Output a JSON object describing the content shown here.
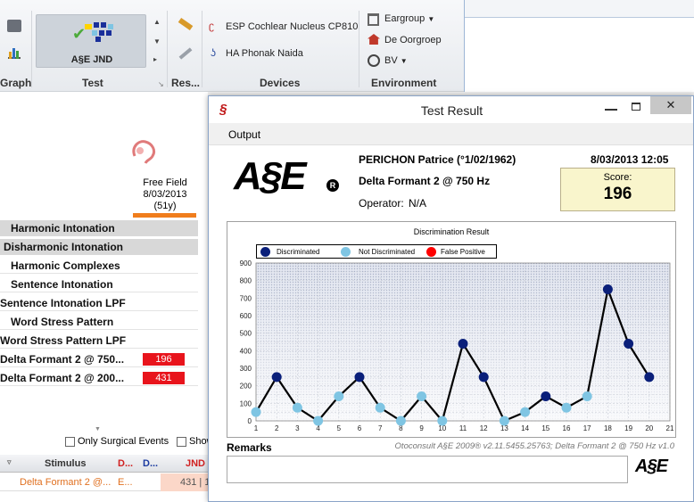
{
  "ribbon": {
    "groups": {
      "graph": "Graph",
      "test": "Test",
      "res": "Res...",
      "devices": "Devices",
      "environment": "Environment"
    },
    "test_button": "A§E JND",
    "devices": [
      "ESP Cochlear Nucleus CP810",
      "HA Phonak Naida"
    ],
    "environment": [
      "Eargroup",
      "De Oorgroep",
      "BV"
    ]
  },
  "session": {
    "label": "Free Field",
    "date": "8/03/2013",
    "age": "(51y)"
  },
  "test_list": [
    {
      "label": "Harmonic Intonation",
      "style": "gray",
      "indent": 12
    },
    {
      "label": "Disharmonic Intonation",
      "style": "gray",
      "indent": 4
    },
    {
      "label": "Harmonic Complexes",
      "style": "row",
      "indent": 12
    },
    {
      "label": "Sentence Intonation",
      "style": "row",
      "indent": 12
    },
    {
      "label": "Sentence Intonation LPF",
      "style": "row",
      "indent": 0
    },
    {
      "label": "Word Stress Pattern",
      "style": "row",
      "indent": 12
    },
    {
      "label": "Word Stress Pattern LPF",
      "style": "row",
      "indent": 0
    },
    {
      "label": "Delta Formant 2 @ 750...",
      "style": "row",
      "indent": 0,
      "badge": "196"
    },
    {
      "label": "Delta Formant 2 @ 200...",
      "style": "row",
      "indent": 0,
      "badge": "431"
    }
  ],
  "filters": {
    "only_surgical": "Only Surgical Events",
    "show": "Show"
  },
  "grid": {
    "headers": [
      "Stimulus",
      "D...",
      "D...",
      "JND"
    ],
    "row": {
      "stimulus": "Delta Formant 2 @...",
      "d1": "E...",
      "jnd": "431 | 1"
    }
  },
  "dialog": {
    "title": "Test Result",
    "menu": "Output",
    "logo": "A§E",
    "patient": "PERICHON Patrice (°1/02/1962)",
    "test": "Delta Formant 2 @ 750 Hz",
    "operator_label": "Operator:",
    "operator": "N/A",
    "datetime": "8/03/2013 12:05",
    "score_label": "Score:",
    "score": "196",
    "remarks_label": "Remarks",
    "footer": "Otoconsult A§E 2009® v2.11.5455.25763; Delta Formant 2 @ 750 Hz v1.0"
  },
  "chart_data": {
    "type": "line",
    "title": "Discrimination Result",
    "legend": [
      "Discriminated",
      "Not Discriminated",
      "False Positive"
    ],
    "colors": {
      "discriminated": "#0a1f7a",
      "not_discriminated": "#7fc5e3",
      "false_positive": "#ff0000"
    },
    "x": [
      1,
      2,
      3,
      4,
      5,
      6,
      7,
      8,
      9,
      10,
      11,
      12,
      13,
      14,
      15,
      16,
      17,
      18,
      19,
      20
    ],
    "y": [
      50,
      250,
      75,
      0,
      140,
      250,
      75,
      0,
      140,
      0,
      440,
      250,
      0,
      50,
      140,
      75,
      140,
      750,
      440,
      250
    ],
    "status": [
      "N",
      "D",
      "N",
      "N",
      "N",
      "D",
      "N",
      "N",
      "N",
      "N",
      "D",
      "D",
      "N",
      "N",
      "D",
      "N",
      "N",
      "D",
      "D",
      "D"
    ],
    "xlim": [
      1,
      21
    ],
    "ylim": [
      0,
      900
    ],
    "yticks": [
      0,
      50,
      100,
      150,
      200,
      250,
      300,
      350,
      400,
      450,
      500,
      550,
      600,
      650,
      700,
      750,
      800,
      850,
      900
    ],
    "xticks": [
      1,
      2,
      3,
      4,
      5,
      6,
      7,
      8,
      9,
      10,
      11,
      12,
      13,
      14,
      15,
      16,
      17,
      18,
      19,
      20,
      21
    ],
    "grid": true
  }
}
